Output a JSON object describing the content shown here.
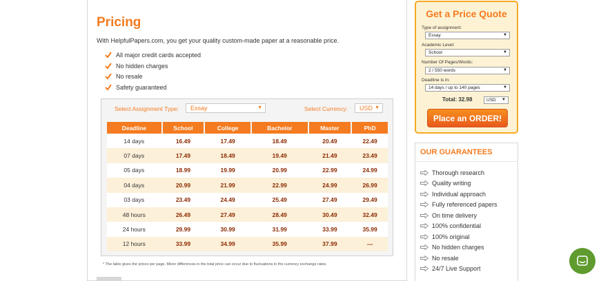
{
  "pricing": {
    "title": "Pricing",
    "intro": "With HelpfulPapers.com, you get your quality custom-made paper at a reasonable price.",
    "features": [
      "All major credit cards accepted",
      "No hidden charges",
      "No resale",
      "Safety guaranteed"
    ],
    "assignment_label": "Select Assignment Type:",
    "assignment_value": "Essay",
    "currency_label": "Select Currency:",
    "currency_value": "USD",
    "table": {
      "headers": [
        "Deadline",
        "School",
        "College",
        "Bachelor",
        "Master",
        "PhD"
      ],
      "rows": [
        [
          "14 days",
          "16.49",
          "17.49",
          "18.49",
          "20.49",
          "22.49"
        ],
        [
          "07 days",
          "17.49",
          "18.49",
          "19.49",
          "21.49",
          "23.49"
        ],
        [
          "05 days",
          "18.99",
          "19.99",
          "20.99",
          "22.99",
          "24.99"
        ],
        [
          "04 days",
          "20.99",
          "21.99",
          "22.99",
          "24.99",
          "26.99"
        ],
        [
          "03 days",
          "23.49",
          "24.49",
          "25.49",
          "27.49",
          "29.49"
        ],
        [
          "48 hours",
          "26.49",
          "27.49",
          "28.49",
          "30.49",
          "32.49"
        ],
        [
          "24 hours",
          "29.99",
          "30.99",
          "31.99",
          "33.99",
          "35.99"
        ],
        [
          "12 hours",
          "33.99",
          "34.99",
          "35.99",
          "37.99",
          "---"
        ]
      ]
    },
    "footnote": "* The table gives the prices per page. Minor differences in the total price can occur due to fluctuations in the currency exchange rates."
  },
  "quote": {
    "title": "Get a Price Quote",
    "type_label": "Type of assignment:",
    "type_value": "Essay",
    "level_label": "Academic Level:",
    "level_value": "School",
    "pages_label": "Number Of Pages/Words:",
    "pages_value": "2 / 550 words",
    "deadline_label": "Deadline is in:",
    "deadline_value": "14 days / up to 140 pages",
    "total": "Total: 32.98",
    "currency_value": "USD",
    "order_label": "Place an ORDER!"
  },
  "guarantees": {
    "title": "OUR GUARANTEES",
    "items": [
      "Thorough research",
      "Quality writing",
      "Individual approach",
      "Fully referenced papers",
      "On time delivery",
      "100% confidential",
      "100% original",
      "No hidden charges",
      "No resale",
      "24/7 Live Support"
    ]
  },
  "colors": {
    "accent": "#f47b20",
    "quote_bg": "#fdf3d4",
    "chat": "#5f9b2e"
  },
  "icons": {
    "feature": "check-icon",
    "guarantee": "arrow-right-icon",
    "chat": "chat-icon"
  }
}
